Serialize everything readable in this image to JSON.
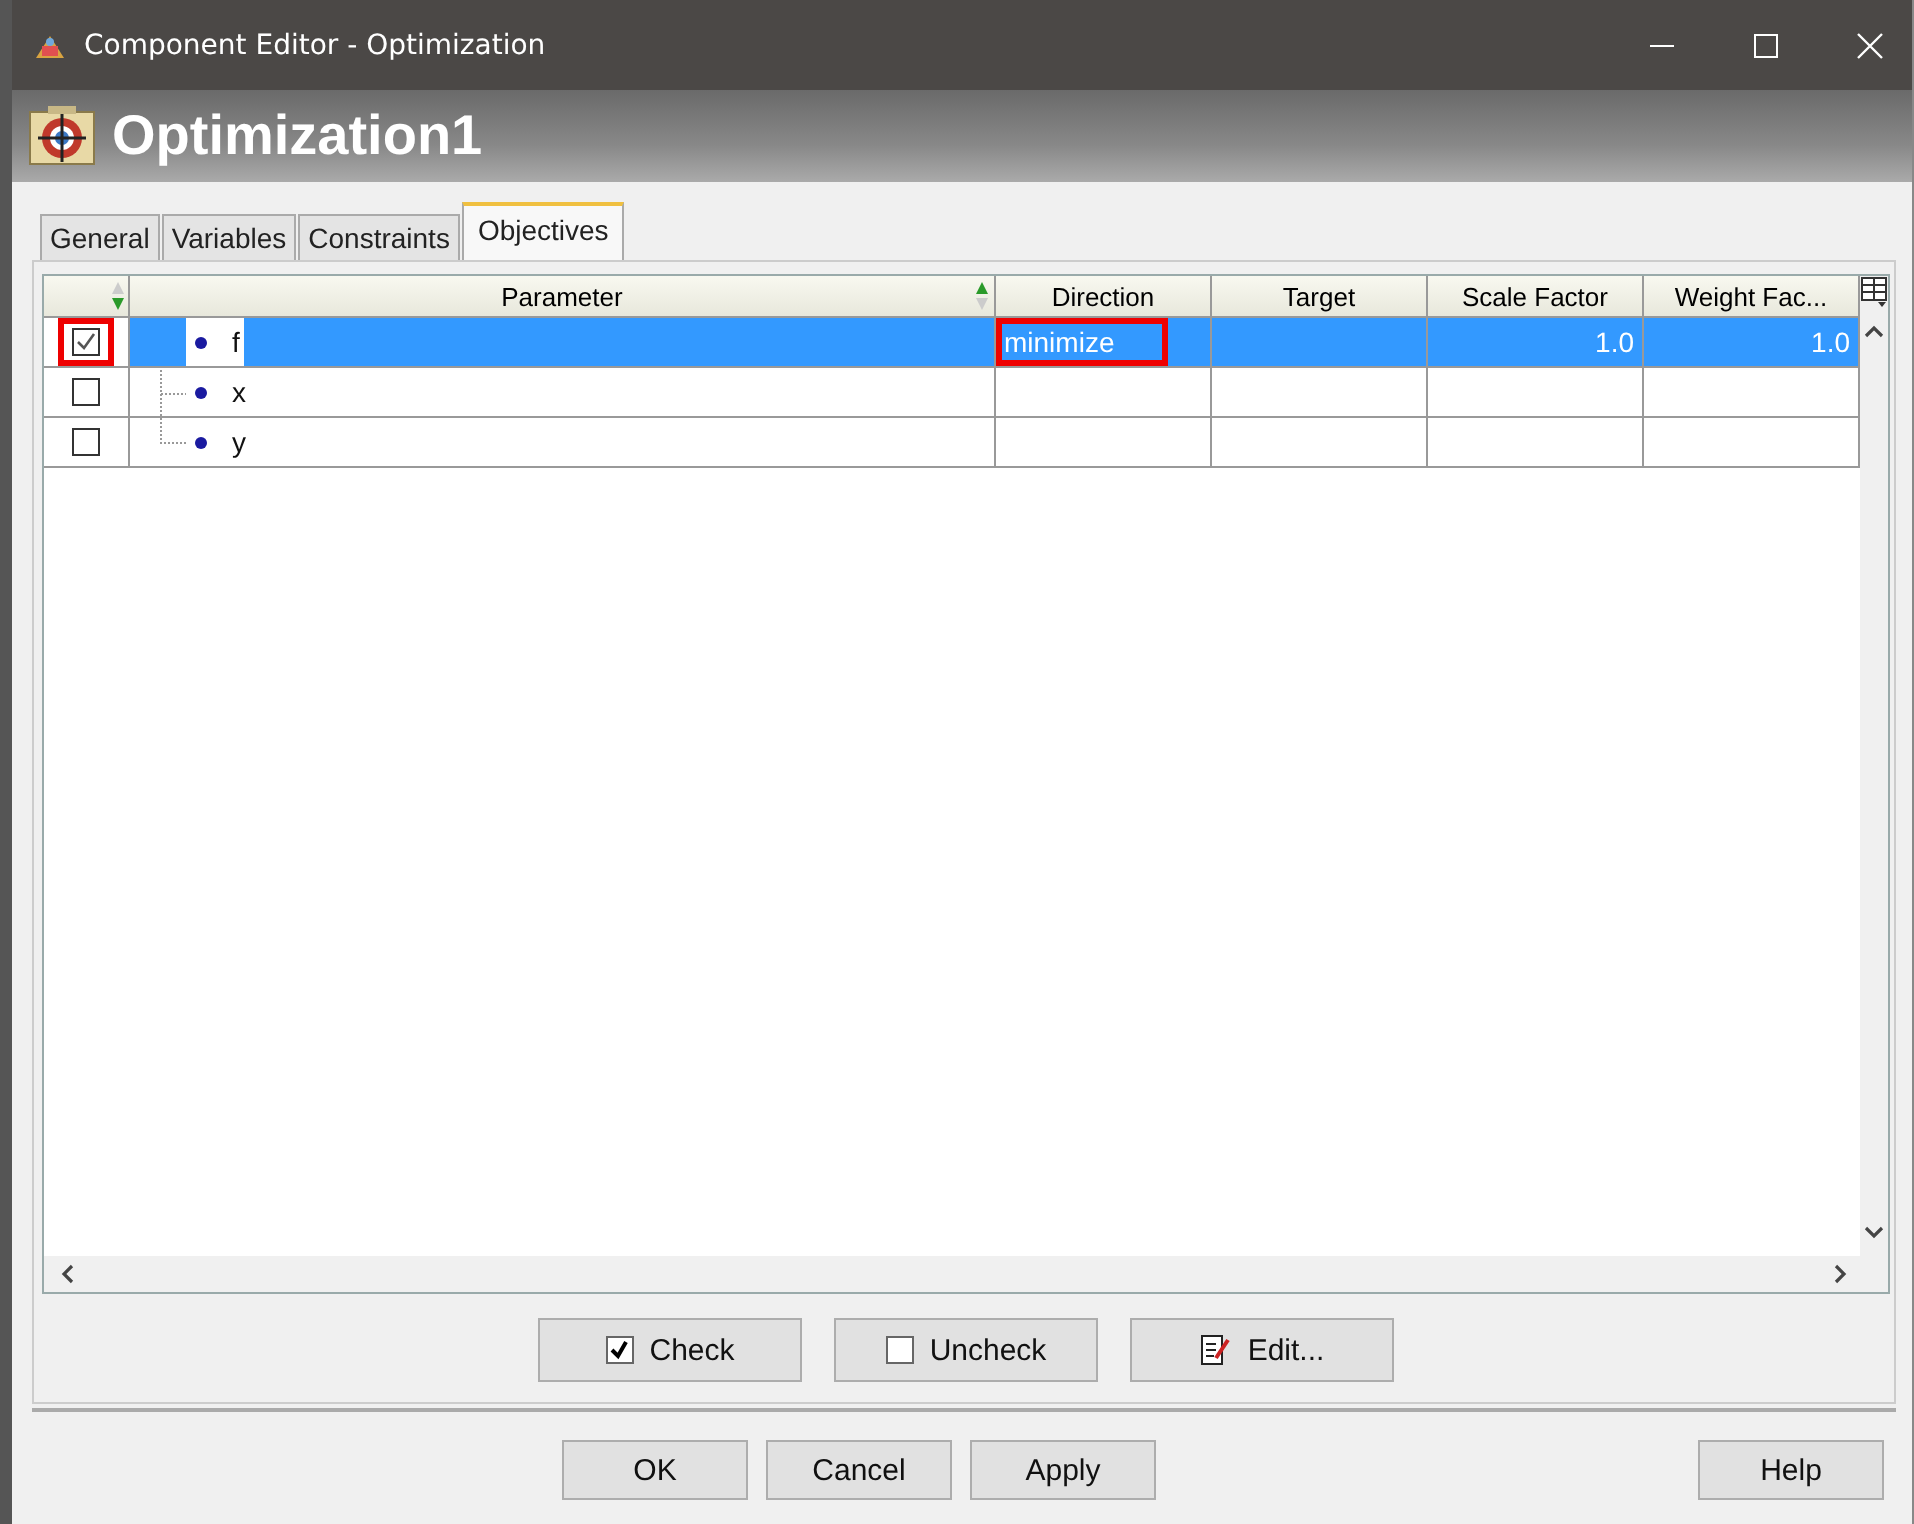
{
  "window": {
    "title": "Component Editor - Optimization"
  },
  "header": {
    "title": "Optimization1"
  },
  "tabs": [
    {
      "label": "General",
      "selected": false
    },
    {
      "label": "Variables",
      "selected": false
    },
    {
      "label": "Constraints",
      "selected": false
    },
    {
      "label": "Objectives",
      "selected": true
    }
  ],
  "table": {
    "columns": [
      "Parameter",
      "Direction",
      "Target",
      "Scale Factor",
      "Weight Fac..."
    ],
    "rows": [
      {
        "checked": true,
        "selected": true,
        "annotated": true,
        "name": "f",
        "direction": "minimize",
        "target": "",
        "scale_factor": "1.0",
        "weight_factor": "1.0"
      },
      {
        "checked": false,
        "selected": false,
        "annotated": false,
        "name": "x",
        "direction": "",
        "target": "",
        "scale_factor": "",
        "weight_factor": ""
      },
      {
        "checked": false,
        "selected": false,
        "annotated": false,
        "name": "y",
        "direction": "",
        "target": "",
        "scale_factor": "",
        "weight_factor": ""
      }
    ]
  },
  "actions": [
    "Check",
    "Uncheck",
    "Edit..."
  ],
  "buttons": [
    "OK",
    "Cancel",
    "Apply"
  ],
  "help": "Help"
}
